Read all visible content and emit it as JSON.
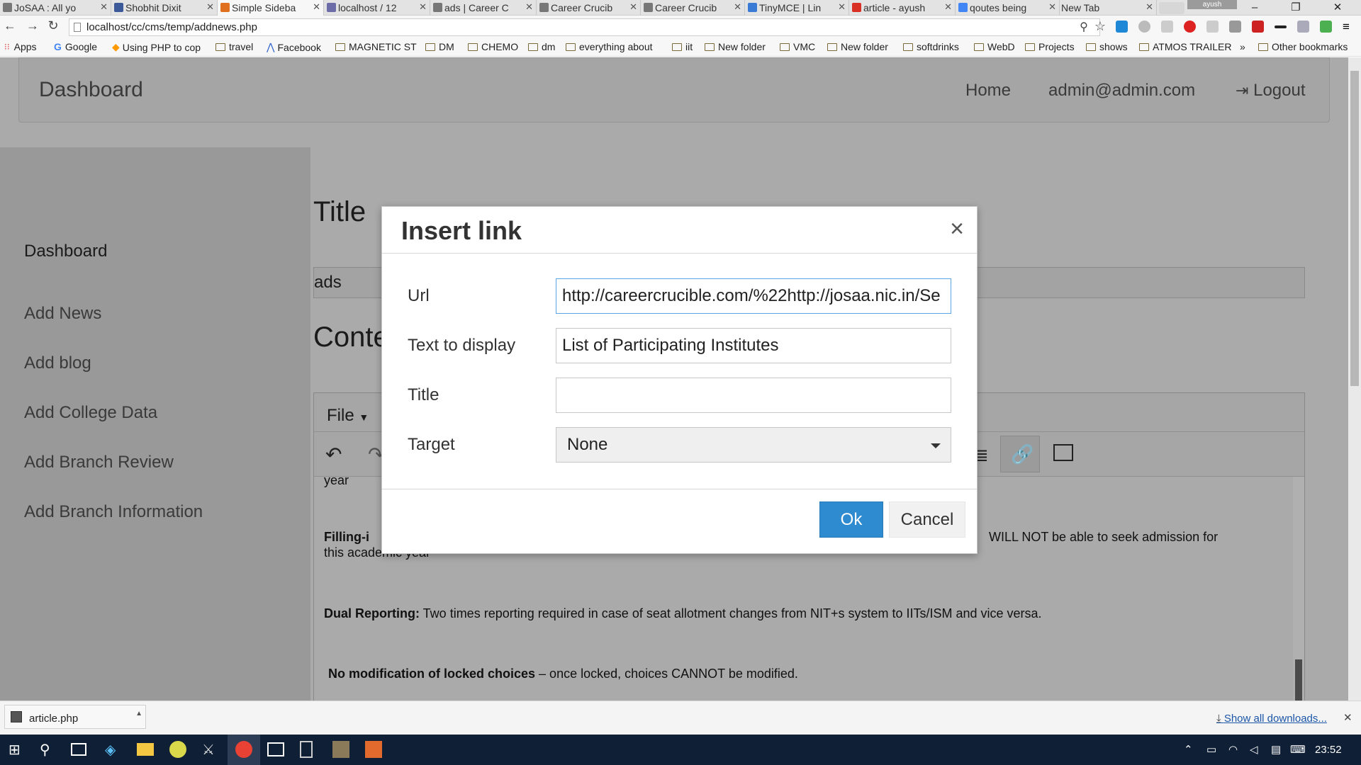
{
  "browser": {
    "tabs": [
      {
        "label": "JoSAA : All yo",
        "favicon_color": "#777777"
      },
      {
        "label": "Shobhit Dixit",
        "favicon_color": "#3b5998"
      },
      {
        "label": "Simple Sideba",
        "favicon_color": "#e07020"
      },
      {
        "label": "localhost / 12",
        "favicon_color": "#6c6ca8"
      },
      {
        "label": "ads | Career C",
        "favicon_color": "#777777"
      },
      {
        "label": "Career Crucib",
        "favicon_color": "#777777"
      },
      {
        "label": "Career Crucib",
        "favicon_color": "#777777"
      },
      {
        "label": "TinyMCE | Lin",
        "favicon_color": "#3a7bd5"
      },
      {
        "label": "article - ayush",
        "favicon_color": "#d93025"
      },
      {
        "label": "qoutes being",
        "favicon_color": "#4285f4"
      },
      {
        "label": "New Tab",
        "favicon_color": "#cccccc"
      }
    ],
    "profile_name": "ayush",
    "url": "localhost/cc/cms/temp/addnews.php",
    "bookmarks": [
      "Apps",
      "Google",
      "Using PHP to cop",
      "travel",
      "Facebook",
      "MAGNETIC ST",
      "DM",
      "CHEMO",
      "dm",
      "everything about",
      "iit",
      "New folder",
      "VMC",
      "New folder",
      "softdrinks",
      "WebD",
      "Projects",
      "shows",
      "ATMOS TRAILER",
      "»",
      "Other bookmarks"
    ]
  },
  "navbar": {
    "brand": "Dashboard",
    "home": "Home",
    "user": "admin@admin.com",
    "logout": "Logout"
  },
  "sidebar": {
    "items": [
      "Dashboard",
      "Add News",
      "Add blog",
      "Add College Data",
      "Add Branch Review",
      "Add Branch Information"
    ]
  },
  "main": {
    "title_heading": "Title",
    "title_value": "ads",
    "content_heading": "Conte",
    "editor_menu_file": "File",
    "content": {
      "line0": "year",
      "p1_bold": "Filling-i",
      "p1_tail": "WILL NOT be able to seek admission for",
      "p1_line2": "this academic year",
      "p2_bold": "Dual Reporting:",
      "p2_text": " Two times reporting required in case of seat allotment changes from NIT+s system to IITs/ISM and vice versa.",
      "p3_bold": "No modification of locked choices",
      "p3_text": " – once locked, choices CANNOT be modified."
    }
  },
  "dialog": {
    "title": "Insert link",
    "close": "×",
    "url_label": "Url",
    "url_value": "http://careercrucible.com/%22http://josaa.nic.in/Se",
    "text_label": "Text to display",
    "text_value": "List of Participating Institutes",
    "title_label": "Title",
    "title_value": "",
    "target_label": "Target",
    "target_value": "None",
    "ok": "Ok",
    "cancel": "Cancel"
  },
  "downloads": {
    "file": "article.php",
    "show_all": "Show all downloads..."
  },
  "taskbar": {
    "time": "23:52"
  }
}
